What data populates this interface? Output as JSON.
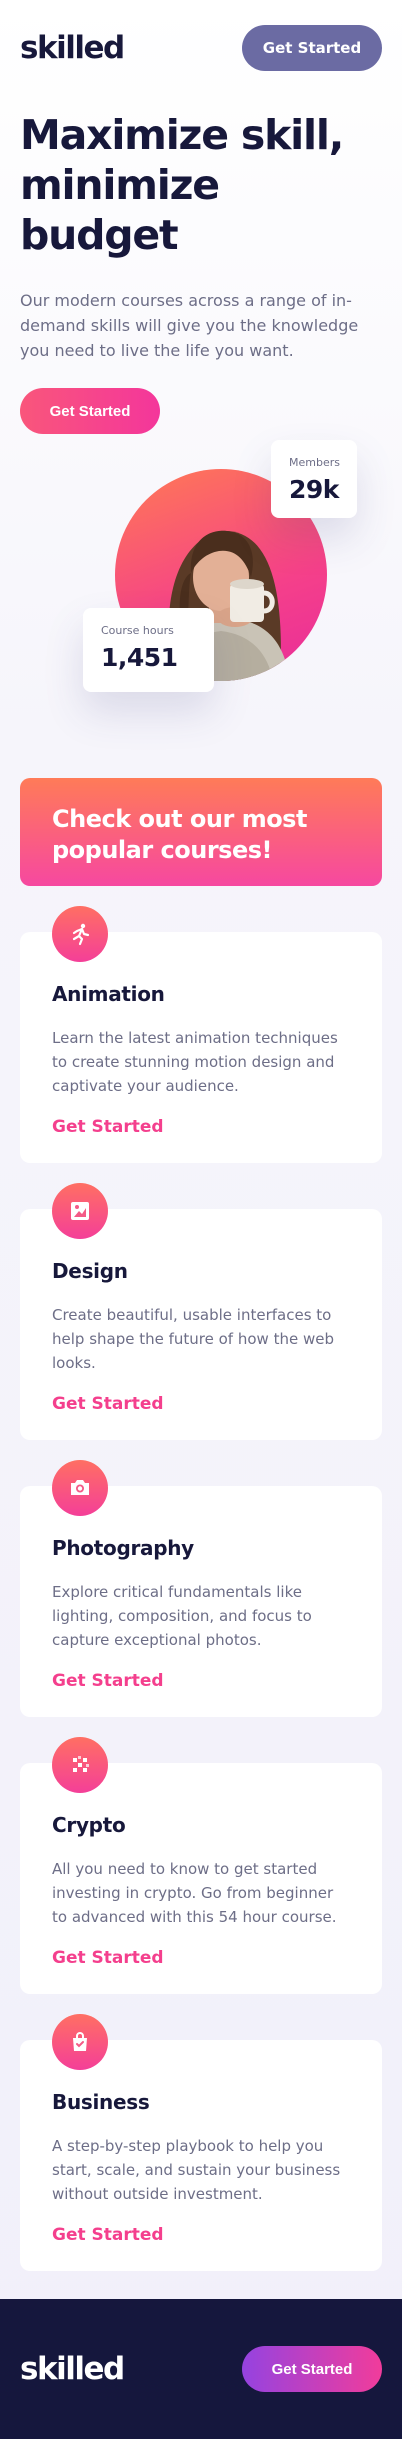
{
  "header": {
    "logo": "skilled",
    "cta_label": "Get Started"
  },
  "hero": {
    "title": "Maximize skill, minimize budget",
    "text": "Our modern courses across a range of in-demand skills will give you the knowledge you need to live the life you want.",
    "cta_label": "Get Started",
    "stats": {
      "members_label": "Members",
      "members_value": "29k",
      "hours_label": "Course hours",
      "hours_value": "1,451"
    }
  },
  "popular": {
    "title": "Check out our most popular courses!"
  },
  "courses": [
    {
      "icon": "running-person-icon",
      "title": "Animation",
      "text": "Learn the latest animation techniques to create stunning motion design and captivate your audience.",
      "link": "Get Started"
    },
    {
      "icon": "image-frame-icon",
      "title": "Design",
      "text": "Create beautiful, usable interfaces to help shape the future of how the web looks.",
      "link": "Get Started"
    },
    {
      "icon": "camera-icon",
      "title": "Photography",
      "text": "Explore critical fundamentals like lighting, composition, and focus to capture exceptional photos.",
      "link": "Get Started"
    },
    {
      "icon": "crypto-grid-icon",
      "title": "Crypto",
      "text": "All you need to know to get started investing in crypto. Go from beginner to advanced with this 54 hour course.",
      "link": "Get Started"
    },
    {
      "icon": "shopping-bag-icon",
      "title": "Business",
      "text": "A step-by-step playbook to help you start, scale, and sustain your business without outside investment.",
      "link": "Get Started"
    }
  ],
  "footer": {
    "logo": "skilled",
    "cta_label": "Get Started"
  },
  "colors": {
    "navy": "#17183b",
    "accent_pink": "#f43f8d",
    "header_button": "#6b6ba3",
    "text_muted": "#6d6e87",
    "footer_bg": "#15173d"
  }
}
